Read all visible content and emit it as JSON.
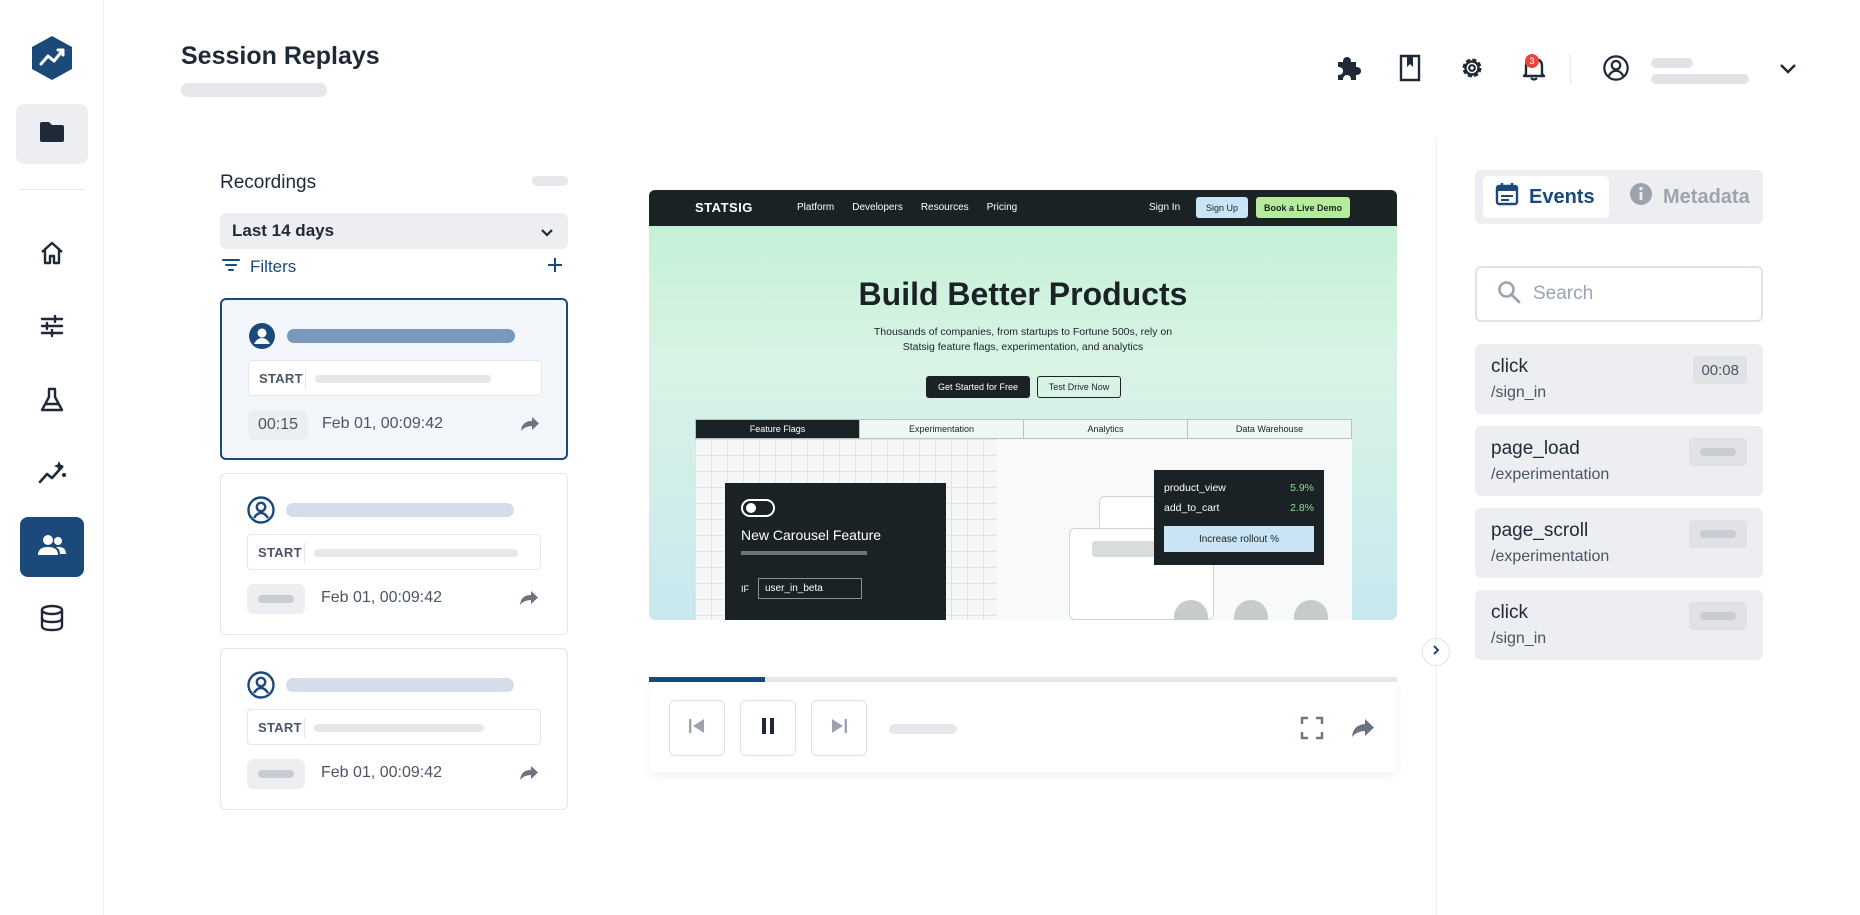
{
  "page": {
    "title": "Session Replays"
  },
  "header": {
    "notification_count": "3"
  },
  "recordings": {
    "title": "Recordings",
    "date_range": "Last 14 days",
    "filters_label": "Filters",
    "start_label": "START",
    "items": [
      {
        "duration": "00:15",
        "timestamp": "Feb 01, 00:09:42",
        "selected": true
      },
      {
        "duration": "",
        "timestamp": "Feb 01, 00:09:42",
        "selected": false
      },
      {
        "duration": "",
        "timestamp": "Feb 01, 00:09:42",
        "selected": false
      }
    ]
  },
  "replay": {
    "brand": "STATSIG",
    "nav_links": [
      "Platform",
      "Developers",
      "Resources",
      "Pricing"
    ],
    "sign_in": "Sign In",
    "sign_up": "Sign Up",
    "demo": "Book a Live Demo",
    "headline": "Build Better Products",
    "subheadline": "Thousands of companies, from startups to Fortune 500s, rely on Statsig feature flags, experimentation, and analytics",
    "cta_primary": "Get Started for Free",
    "cta_secondary": "Test Drive Now",
    "tabs": [
      "Feature Flags",
      "Experimentation",
      "Analytics",
      "Data Warehouse"
    ],
    "feature_card_title": "New Carousel Feature",
    "condition_if": "IF",
    "condition_value": "user_in_beta",
    "metrics": [
      {
        "name": "product_view",
        "value": "5.9%"
      },
      {
        "name": "add_to_cart",
        "value": "2.8%"
      }
    ],
    "rollout_button": "Increase rollout %"
  },
  "player": {
    "progress": 0.155
  },
  "events_panel": {
    "tabs": {
      "events": "Events",
      "metadata": "Metadata"
    },
    "search_placeholder": "Search",
    "events": [
      {
        "name": "click",
        "path": "/sign_in",
        "time": "00:08"
      },
      {
        "name": "page_load",
        "path": "/experimentation",
        "time": ""
      },
      {
        "name": "page_scroll",
        "path": "/experimentation",
        "time": ""
      },
      {
        "name": "click",
        "path": "/sign_in",
        "time": ""
      }
    ]
  },
  "colors": {
    "accent": "#1b4a7a",
    "badge": "#e8453c"
  }
}
